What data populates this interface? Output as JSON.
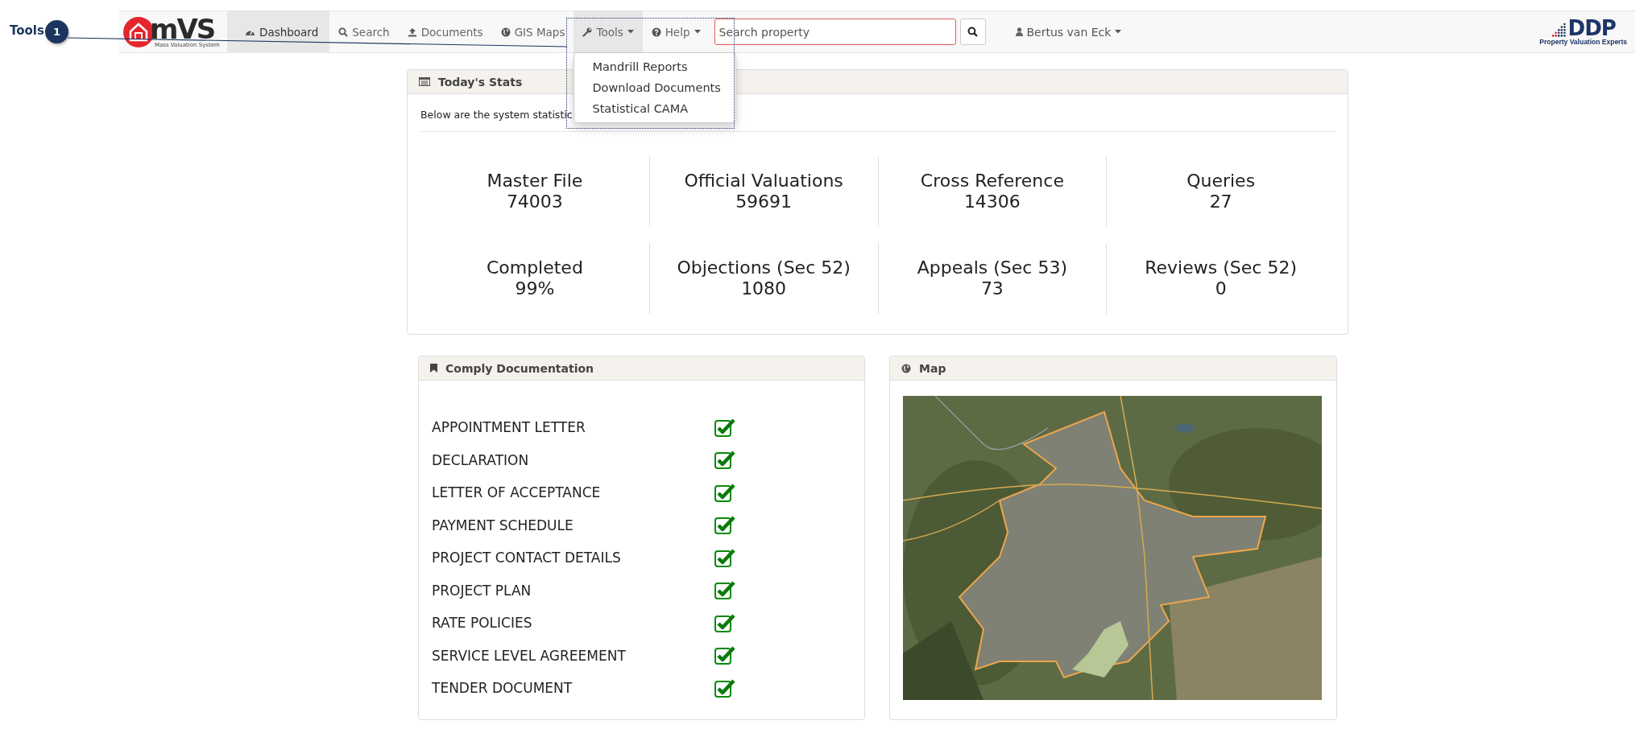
{
  "annotation": {
    "label": "Tools",
    "number": "1"
  },
  "navbar": {
    "logo": {
      "name": "mVS",
      "tagline": "Mass Valuation System"
    },
    "items": [
      {
        "label": "Dashboard",
        "kind": "link",
        "selected": true
      },
      {
        "label": "Search",
        "kind": "link",
        "selected": false
      },
      {
        "label": "Documents",
        "kind": "link",
        "selected": false
      },
      {
        "label": "GIS Maps",
        "kind": "link",
        "selected": false
      },
      {
        "label": "Tools",
        "kind": "dropdown",
        "selected": false,
        "expanded": true,
        "menu": [
          "Mandrill Reports",
          "Download Documents",
          "Statistical CAMA"
        ]
      },
      {
        "label": "Help",
        "kind": "dropdown",
        "selected": false,
        "expanded": false
      }
    ],
    "search": {
      "placeholder": "Search property"
    },
    "user": "Bertus van Eck",
    "brand": {
      "name": "DDP",
      "tagline": "Property Valuation Experts"
    }
  },
  "stats": {
    "title": "Today's Stats",
    "intro": "Below are the system statistic",
    "items": [
      {
        "label": "Master File",
        "value": "74003"
      },
      {
        "label": "Official Valuations",
        "value": "59691"
      },
      {
        "label": "Cross Reference",
        "value": "14306"
      },
      {
        "label": "Queries",
        "value": "27"
      },
      {
        "label": "Completed",
        "value": "99%"
      },
      {
        "label": "Objections (Sec 52)",
        "value": "1080"
      },
      {
        "label": "Appeals (Sec 53)",
        "value": "73"
      },
      {
        "label": "Reviews (Sec 52)",
        "value": "0"
      }
    ]
  },
  "comply": {
    "title": "Comply Documentation",
    "items": [
      {
        "label": "APPOINTMENT LETTER",
        "checked": true
      },
      {
        "label": "DECLARATION",
        "checked": true
      },
      {
        "label": "LETTER OF ACCEPTANCE",
        "checked": true
      },
      {
        "label": "PAYMENT SCHEDULE",
        "checked": true
      },
      {
        "label": "PROJECT CONTACT DETAILS",
        "checked": true
      },
      {
        "label": "PROJECT PLAN",
        "checked": true
      },
      {
        "label": "RATE POLICIES",
        "checked": true
      },
      {
        "label": "SERVICE LEVEL AGREEMENT",
        "checked": true
      },
      {
        "label": "TENDER DOCUMENT",
        "checked": true
      }
    ]
  },
  "map": {
    "title": "Map",
    "kind": "picture"
  }
}
